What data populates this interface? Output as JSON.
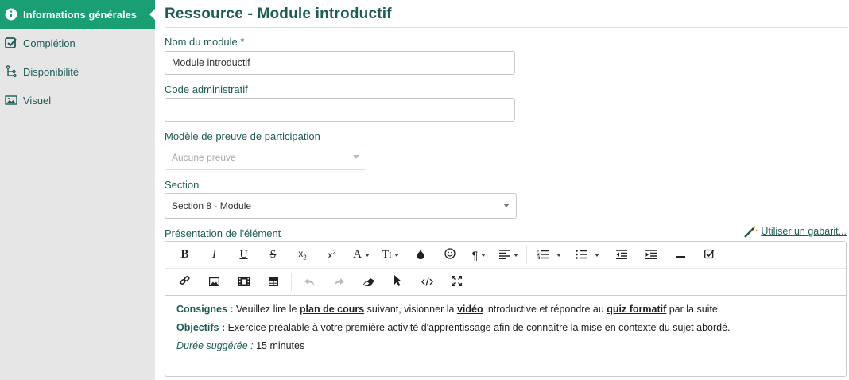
{
  "sidebar": {
    "items": [
      {
        "label": "Informations générales",
        "icon": "info-icon",
        "active": true
      },
      {
        "label": "Complétion",
        "icon": "checkbox-icon",
        "active": false
      },
      {
        "label": "Disponibilité",
        "icon": "branch-icon",
        "active": false
      },
      {
        "label": "Visuel",
        "icon": "image-icon",
        "active": false
      }
    ]
  },
  "page": {
    "title": "Ressource - Module introductif"
  },
  "form": {
    "module_name_label": "Nom du module *",
    "module_name_value": "Module introductif",
    "admin_code_label": "Code administratif",
    "admin_code_value": "",
    "proof_label": "Modèle de preuve de participation",
    "proof_value": "Aucune preuve",
    "section_label": "Section",
    "section_value": "Section 8 - Module",
    "presentation_label": "Présentation de l'élément",
    "template_link": "Utiliser un gabarit..."
  },
  "editor": {
    "line1": {
      "key": "Consignes :",
      "t1": " Veuillez lire le ",
      "u1": "plan de cours",
      "t2": " suivant, visionner la ",
      "u2": "vidéo",
      "t3": " introductive et répondre au ",
      "u3": "quiz formatif",
      "t4": " par la suite."
    },
    "line2": {
      "key": "Objectifs :",
      "text": " Exercice préalable à votre première activité d'apprentissage afin de connaître la mise en contexte du sujet abordé."
    },
    "line3": {
      "key": "Durée suggérée :",
      "text": " 15 minutes"
    }
  },
  "colors": {
    "accent": "#1a9e73",
    "text_dark": "#1f5c55",
    "sidebar_bg": "#e6e6e6"
  }
}
